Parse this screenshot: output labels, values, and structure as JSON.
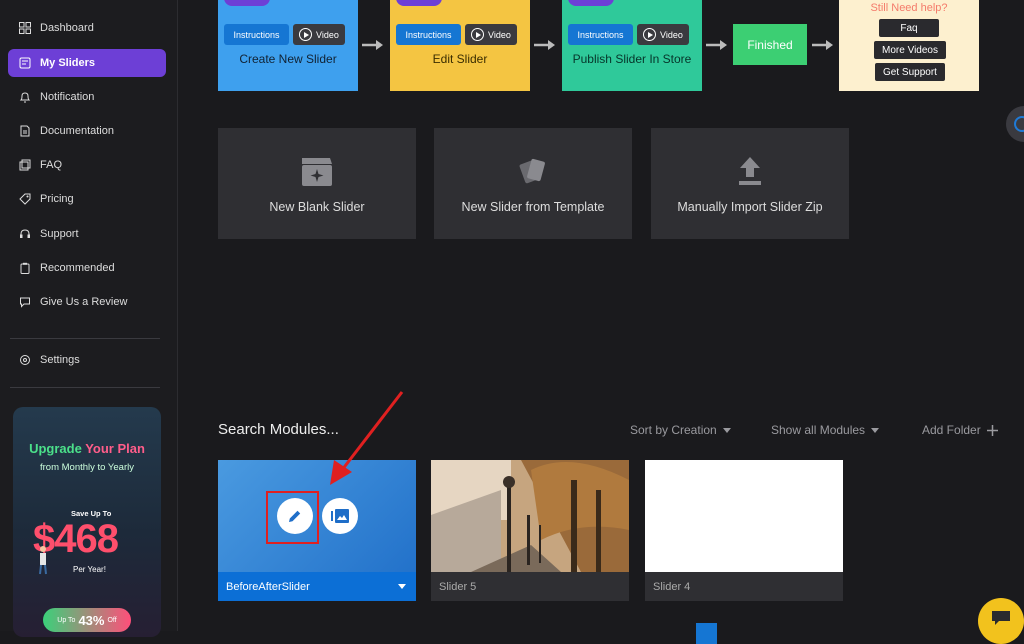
{
  "sidebar": {
    "items": [
      {
        "label": "Dashboard",
        "icon": "dashboard-icon"
      },
      {
        "label": "My Sliders",
        "icon": "sliders-icon",
        "active": true
      },
      {
        "label": "Notification",
        "icon": "bell-icon"
      },
      {
        "label": "Documentation",
        "icon": "document-icon"
      },
      {
        "label": "FAQ",
        "icon": "faq-icon"
      },
      {
        "label": "Pricing",
        "icon": "pricing-icon"
      },
      {
        "label": "Support",
        "icon": "support-icon"
      },
      {
        "label": "Recommended",
        "icon": "clipboard-icon"
      },
      {
        "label": "Give Us a Review",
        "icon": "chat-icon"
      }
    ],
    "settings": "Settings"
  },
  "promo": {
    "title_a": "Upgrade ",
    "title_b": "Your Plan",
    "subtitle": "from Monthly to Yearly",
    "save": "Save Up To",
    "amount": "$468",
    "per": "Per Year!",
    "badge_pre": "Up To",
    "badge_pct": "43%",
    "badge_post": "Off"
  },
  "steps": [
    {
      "instructions": "Instructions",
      "video": "Video",
      "label": "Create New Slider",
      "color": "#3ea0ee"
    },
    {
      "instructions": "Instructions",
      "video": "Video",
      "label": "Edit Slider",
      "color": "#f4c542"
    },
    {
      "instructions": "Instructions",
      "video": "Video",
      "label": "Publish Slider In Store",
      "color": "#2fc99a"
    }
  ],
  "finished": "Finished",
  "help": {
    "title": "Still Need help?",
    "faq": "Faq",
    "videos": "More Videos",
    "support": "Get Support"
  },
  "create": {
    "blank": "New Blank Slider",
    "template": "New Slider from Template",
    "import": "Manually Import Slider Zip"
  },
  "modules": {
    "search": "Search Modules...",
    "sort": "Sort by Creation",
    "show": "Show all Modules",
    "add_folder": "Add Folder",
    "items": [
      {
        "name": "BeforeAfterSlider"
      },
      {
        "name": "Slider 5"
      },
      {
        "name": "Slider 4"
      }
    ]
  },
  "colors": {
    "accent": "#6d3fd6",
    "primary": "#1576d3",
    "finished": "#3ccf73",
    "annotation": "#e02020"
  }
}
